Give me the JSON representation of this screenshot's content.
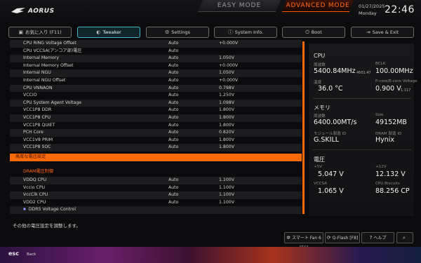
{
  "header": {
    "brand": "AORUS",
    "mode_easy": "EASY MODE",
    "mode_advanced": "ADVANCED MODE",
    "date": "01/27/2025",
    "day": "Monday",
    "time": "22:46"
  },
  "tabs": [
    {
      "label": "お気に入り (F11)",
      "icon": "star-icon"
    },
    {
      "label": "Tweaker",
      "icon": "tweaker-icon"
    },
    {
      "label": "Settings",
      "icon": "gear-icon"
    },
    {
      "label": "System Info.",
      "icon": "info-icon"
    },
    {
      "label": "Boot",
      "icon": "power-icon"
    },
    {
      "label": "Save & Exit",
      "icon": "exit-icon"
    }
  ],
  "rows": [
    {
      "name": "CPU RING Voltage Offset",
      "value": "Auto",
      "volt": "+0.000V"
    },
    {
      "name": "CPU VCCSA(アンコア部)電圧",
      "value": "Auto",
      "volt": ""
    },
    {
      "name": "Internal Memory",
      "value": "Auto",
      "volt": "1.050V"
    },
    {
      "name": "Internal Memory Offset",
      "value": "Auto",
      "volt": "+0.000V"
    },
    {
      "name": "Internal NGU",
      "value": "Auto",
      "volt": "1.050V"
    },
    {
      "name": "Internal NGU Offset",
      "value": "Auto",
      "volt": "+0.000V"
    },
    {
      "name": "CPU VNNAON",
      "value": "Auto",
      "volt": "0.798V"
    },
    {
      "name": "VCCIO",
      "value": "Auto",
      "volt": "1.250V"
    },
    {
      "name": "CPU System Agent Voltage",
      "value": "Auto",
      "volt": "1.098V"
    },
    {
      "name": "VCC1P8 DDR",
      "value": "Auto",
      "volt": "1.800V"
    },
    {
      "name": "VCC1P8 CPU",
      "value": "Auto",
      "volt": "1.800V"
    },
    {
      "name": "VCC1P8 QUIET",
      "value": "Auto",
      "volt": "1.800V"
    },
    {
      "name": "PCH Core",
      "value": "Auto",
      "volt": "0.820V"
    },
    {
      "name": "VCC1V8 PRIM",
      "value": "Auto",
      "volt": "1.800V"
    },
    {
      "name": "VCC1P8 SOC",
      "value": "Auto",
      "volt": "1.800V"
    },
    {
      "name": "高度な電圧設定",
      "value": "",
      "volt": "",
      "kind": "selected"
    },
    {
      "name": "",
      "value": "",
      "volt": "",
      "kind": "blank"
    },
    {
      "name": "DRAM電圧制御",
      "value": "",
      "volt": "",
      "kind": "header"
    },
    {
      "name": "VDDQ CPU",
      "value": "Auto",
      "volt": "1.100V"
    },
    {
      "name": "Vccio CPU",
      "value": "Auto",
      "volt": "1.100V"
    },
    {
      "name": "VccClk CPU",
      "value": "Auto",
      "volt": "1.100V"
    },
    {
      "name": "VDD2 CPU",
      "value": "Auto",
      "volt": "1.100V"
    },
    {
      "name": "DDR5 Voltage Control",
      "value": "",
      "volt": "",
      "kind": "bullet"
    }
  ],
  "side": {
    "cpu_title": "CPU",
    "freq_label": "周波数",
    "freq_value": "5400.84MHz",
    "freq_small": "4601.47",
    "bclk_label": "BCLK",
    "bclk_value": "100.00MHz",
    "bclk_small": "100.00",
    "temp_label": "温度",
    "temp_value": "36.0 °C",
    "vcore_label": "P-core/E-core Voltage",
    "vcore_value": "0.900 V",
    "vcore_small": "1.117",
    "mem_title": "メモリ",
    "mem_freq_label": "周波数",
    "mem_freq_value": "6400.00MT/s",
    "size_label": "Size",
    "size_value": "49152MB",
    "mod_label": "モジュール製造 ID",
    "mod_value": "G.SKILL",
    "dram_label": "DRAM 製造 ID",
    "dram_value": "Hynix",
    "volt_title": "電圧",
    "p5_label": "+5V",
    "p5_value": "5.047 V",
    "p12_label": "+12V",
    "p12_value": "12.132 V",
    "vccsa_label": "VCCSA",
    "vccsa_value": "1.065 V",
    "fan_label": "CPU Biscuits",
    "fan_value": "88.256 CP"
  },
  "footer": {
    "hint": "その他の電圧設定を調整します。",
    "smartfan": "スマート Fan 6 [F6]",
    "qflash": "Q-Flash [F8]",
    "help": "ヘルプ",
    "esc": "esc",
    "back": "Back"
  },
  "colors": {
    "accent": "#ff6a00",
    "tab_active": "#3fb6c8"
  }
}
